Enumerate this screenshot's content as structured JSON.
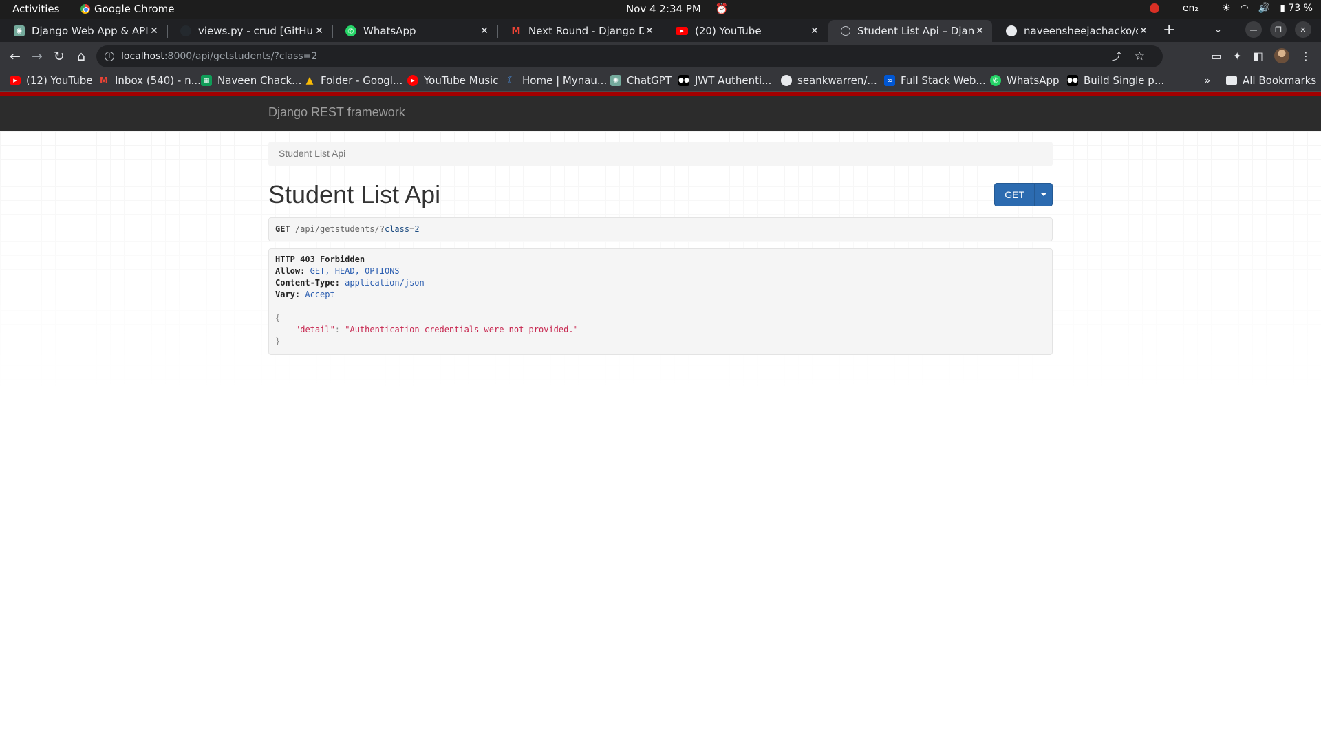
{
  "system": {
    "activities": "Activities",
    "app_name": "Google Chrome",
    "clock": "Nov 4  2:34 PM",
    "lang": "en₂",
    "battery": "73 %"
  },
  "tabs": [
    {
      "label": "Django Web App & API",
      "icon": "chatgpt-icon"
    },
    {
      "label": "views.py - crud [GitHub] -",
      "icon": "github-icon"
    },
    {
      "label": "WhatsApp",
      "icon": "whatsapp-icon"
    },
    {
      "label": "Next Round - Django Dev",
      "icon": "gmail-icon"
    },
    {
      "label": "(20) YouTube",
      "icon": "youtube-icon"
    },
    {
      "label": "Student List Api – Django",
      "icon": "globe-icon"
    },
    {
      "label": "naveensheejachacko/cor",
      "icon": "github-icon"
    }
  ],
  "toolbar": {
    "url_host": "localhost",
    "url_path": ":8000/api/getstudents/?class=2"
  },
  "bookmarks": [
    {
      "label": "(12) YouTube",
      "icon": "youtube-icon",
      "color": "#ff0000"
    },
    {
      "label": "Inbox (540) - n...",
      "icon": "gmail-icon",
      "color": "#ea4335"
    },
    {
      "label": "Naveen Chack...",
      "icon": "sheets-icon",
      "color": "#0f9d58"
    },
    {
      "label": "Folder - Googl...",
      "icon": "drive-icon",
      "color": "#fbbc05"
    },
    {
      "label": "YouTube Music",
      "icon": "youtube-music-icon",
      "color": "#ff0000"
    },
    {
      "label": "Home | Mynau...",
      "icon": "mynaukri-icon",
      "color": "#4a90e2"
    },
    {
      "label": "ChatGPT",
      "icon": "chatgpt-icon",
      "color": "#74aa9c"
    },
    {
      "label": "JWT Authenti...",
      "icon": "medium-icon",
      "color": "#000000"
    },
    {
      "label": "seankwarren/...",
      "icon": "github-icon",
      "color": "#24292e"
    },
    {
      "label": "Full Stack Web...",
      "icon": "coursera-icon",
      "color": "#0056d2"
    },
    {
      "label": "WhatsApp",
      "icon": "whatsapp-icon",
      "color": "#25d366"
    },
    {
      "label": "Build Single p...",
      "icon": "medium-icon",
      "color": "#000000"
    }
  ],
  "all_bookmarks": "All Bookmarks",
  "page": {
    "brand": "Django REST framework",
    "breadcrumb": "Student List Api",
    "title": "Student List Api",
    "get_button": "GET",
    "request": {
      "method": "GET",
      "url_prefix": "/api/getstudents/?",
      "param_key": "class",
      "param_eq": "=",
      "param_val": "2"
    },
    "response": {
      "status": "HTTP 403 Forbidden",
      "headers": [
        {
          "name": "Allow:",
          "value": "GET, HEAD, OPTIONS"
        },
        {
          "name": "Content-Type:",
          "value": "application/json"
        },
        {
          "name": "Vary:",
          "value": "Accept"
        }
      ],
      "open_brace": "{",
      "json_key": "\"detail\"",
      "json_colon": ": ",
      "json_value": "\"Authentication credentials were not provided.\"",
      "close_brace": "}"
    }
  }
}
